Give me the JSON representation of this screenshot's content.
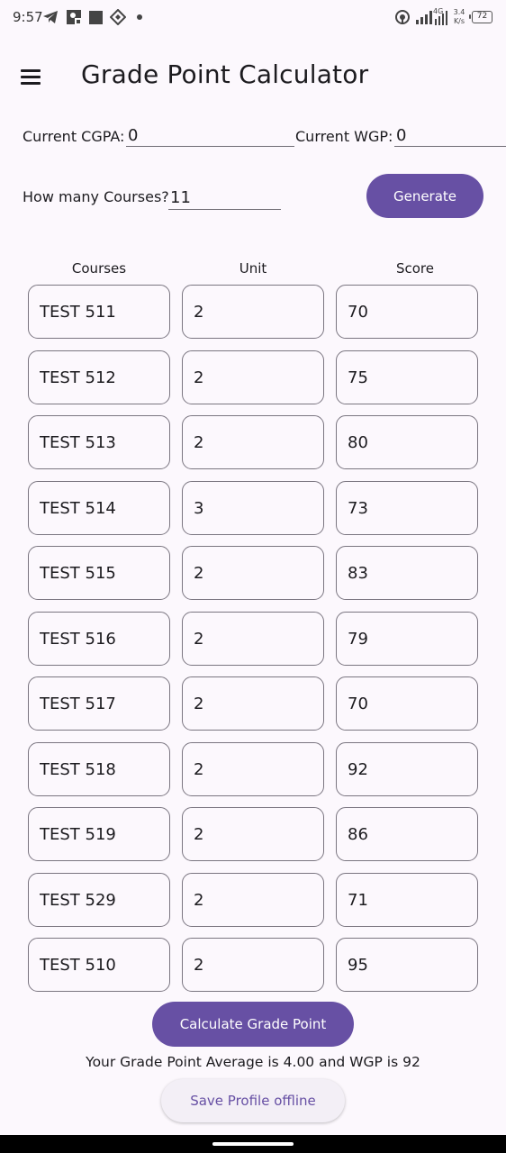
{
  "status_bar": {
    "time": "9:57",
    "network": "4G",
    "speed": "3.4 K/s",
    "battery": "72",
    "icons": [
      "telegram-icon",
      "photo-icon",
      "square-icon",
      "app-icon",
      "dot-icon",
      "hotspot-icon",
      "signal-icon",
      "wifi-icon"
    ]
  },
  "app_bar": {
    "title": "Grade Point Calculator",
    "menu_icon": "menu-icon"
  },
  "fields": {
    "cgpa_label": "Current CGPA:",
    "cgpa_value": "0",
    "wgp_label": "Current WGP:",
    "wgp_value": "0",
    "courses_label": "How many Courses?",
    "courses_value": "11",
    "generate_label": "Generate"
  },
  "table": {
    "headers": [
      "Courses",
      "Unit",
      "Score"
    ],
    "rows": [
      {
        "course": "TEST 511",
        "unit": "2",
        "score": "70"
      },
      {
        "course": "TEST 512",
        "unit": "2",
        "score": "75"
      },
      {
        "course": "TEST 513",
        "unit": "2",
        "score": "80"
      },
      {
        "course": "TEST 514",
        "unit": "3",
        "score": "73"
      },
      {
        "course": "TEST 515",
        "unit": "2",
        "score": "83"
      },
      {
        "course": "TEST 516",
        "unit": "2",
        "score": "79"
      },
      {
        "course": "TEST 517",
        "unit": "2",
        "score": "70"
      },
      {
        "course": "TEST 518",
        "unit": "2",
        "score": "92"
      },
      {
        "course": "TEST 519",
        "unit": "2",
        "score": "86"
      },
      {
        "course": "TEST 529",
        "unit": "2",
        "score": "71"
      },
      {
        "course": "TEST 510",
        "unit": "2",
        "score": "95"
      }
    ]
  },
  "actions": {
    "calculate_label": "Calculate Grade Point",
    "result_text": "Your Grade Point Average is 4.00 and WGP is 92",
    "save_label": "Save Profile offline"
  },
  "colors": {
    "primary": "#6750a4",
    "background": "#fcf8fd",
    "outline": "#7a7580"
  }
}
